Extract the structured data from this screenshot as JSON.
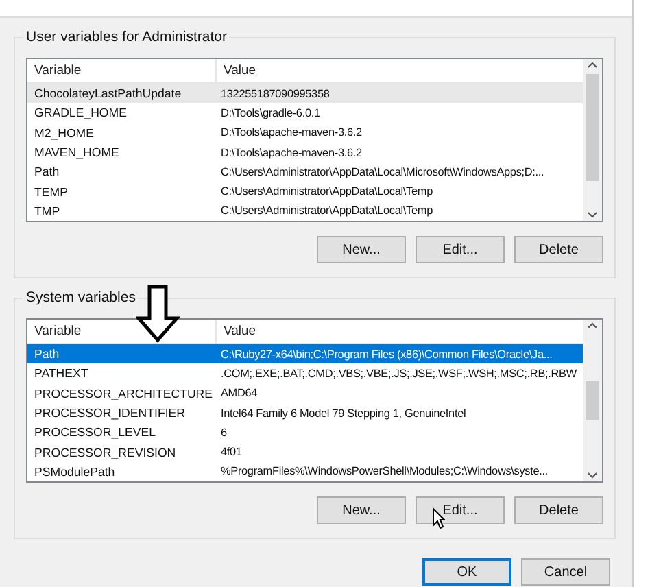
{
  "user_variables": {
    "title": "User variables for Administrator",
    "columns": [
      "Variable",
      "Value"
    ],
    "rows": [
      {
        "variable": "ChocolateyLastPathUpdate",
        "value": "132255187090995358",
        "selected": true
      },
      {
        "variable": "GRADLE_HOME",
        "value": "D:\\Tools\\gradle-6.0.1",
        "selected": false
      },
      {
        "variable": "M2_HOME",
        "value": "D:\\Tools\\apache-maven-3.6.2",
        "selected": false
      },
      {
        "variable": "MAVEN_HOME",
        "value": "D:\\Tools\\apache-maven-3.6.2",
        "selected": false
      },
      {
        "variable": "Path",
        "value": "C:\\Users\\Administrator\\AppData\\Local\\Microsoft\\WindowsApps;D:...",
        "selected": false
      },
      {
        "variable": "TEMP",
        "value": "C:\\Users\\Administrator\\AppData\\Local\\Temp",
        "selected": false
      },
      {
        "variable": "TMP",
        "value": "C:\\Users\\Administrator\\AppData\\Local\\Temp",
        "selected": false
      }
    ],
    "buttons": [
      "New...",
      "Edit...",
      "Delete"
    ]
  },
  "system_variables": {
    "title": "System variables",
    "columns": [
      "Variable",
      "Value"
    ],
    "rows": [
      {
        "variable": "Path",
        "value": "C:\\Ruby27-x64\\bin;C:\\Program Files (x86)\\Common Files\\Oracle\\Ja...",
        "selected": true
      },
      {
        "variable": "PATHEXT",
        "value": ".COM;.EXE;.BAT;.CMD;.VBS;.VBE;.JS;.JSE;.WSF;.WSH;.MSC;.RB;.RBW",
        "selected": false
      },
      {
        "variable": "PROCESSOR_ARCHITECTURE",
        "value": "AMD64",
        "selected": false
      },
      {
        "variable": "PROCESSOR_IDENTIFIER",
        "value": "Intel64 Family 6 Model 79 Stepping 1, GenuineIntel",
        "selected": false
      },
      {
        "variable": "PROCESSOR_LEVEL",
        "value": "6",
        "selected": false
      },
      {
        "variable": "PROCESSOR_REVISION",
        "value": "4f01",
        "selected": false
      },
      {
        "variable": "PSModulePath",
        "value": "%ProgramFiles%\\WindowsPowerShell\\Modules;C:\\Windows\\syste...",
        "selected": false
      }
    ],
    "buttons": [
      "New...",
      "Edit...",
      "Delete"
    ]
  },
  "dialog_buttons": [
    {
      "label": "OK",
      "default": true
    },
    {
      "label": "Cancel",
      "default": false
    }
  ]
}
